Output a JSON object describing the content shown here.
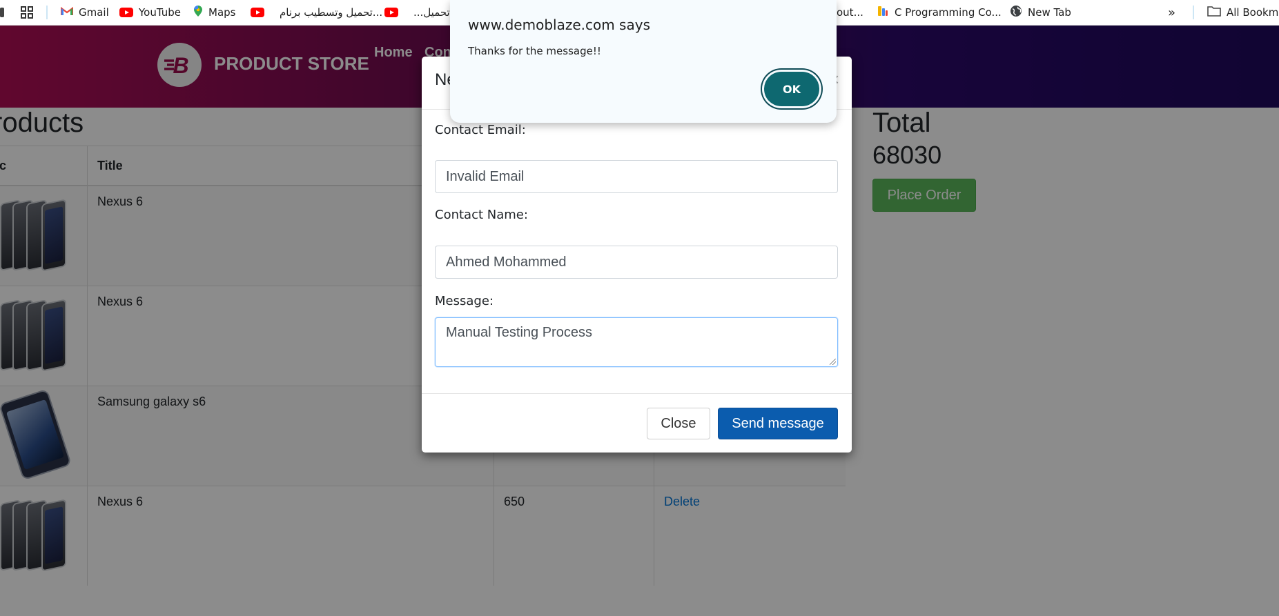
{
  "bookmarks": {
    "items": [
      {
        "icon": "gmail-icon",
        "label": "Gmail"
      },
      {
        "icon": "youtube-icon",
        "label": "YouTube"
      },
      {
        "icon": "maps-icon",
        "label": "Maps"
      },
      {
        "icon": "youtube-icon",
        "label": "تحميل وتسطيب برنام..."
      },
      {
        "icon": "youtube-icon",
        "label": "...ن تحميل"
      },
      {
        "icon": "bookmark-icon",
        "label": "out..."
      },
      {
        "icon": "c-programming-icon",
        "label": "C Programming Co..."
      },
      {
        "icon": "globe-icon",
        "label": "New Tab"
      }
    ],
    "more_label": "»",
    "all_bookmarks_label": "All Bookma"
  },
  "navbar": {
    "brand": "PRODUCT STORE",
    "links": [
      "Home",
      "Con"
    ]
  },
  "cart": {
    "heading": "roducts",
    "columns": [
      "ic",
      "Title",
      "",
      ""
    ],
    "rows": [
      {
        "title": "Nexus 6",
        "price": "",
        "action": ""
      },
      {
        "title": "Nexus 6",
        "price": "",
        "action": ""
      },
      {
        "title": "Samsung galaxy s6",
        "price": "",
        "action": ""
      },
      {
        "title": "Nexus 6",
        "price": "650",
        "action": "Delete"
      }
    ],
    "total_heading": "Total",
    "total_value": "68030",
    "place_order": "Place Order"
  },
  "modal": {
    "title": "Ne",
    "close_x": "×",
    "email_label": "Contact Email:",
    "email_value": "Invalid Email",
    "name_label": "Contact Name:",
    "name_value": "Ahmed Mohammed",
    "message_label": "Message:",
    "message_value": "Manual Testing Process",
    "close_button": "Close",
    "send_button": "Send message"
  },
  "alert": {
    "title": "www.demoblaze.com says",
    "message": "Thanks for the message!!",
    "ok_button": "OK"
  },
  "colors": {
    "navbar_start": "#b00e55",
    "navbar_end": "#1f0a5d",
    "send_button": "#0b5cae",
    "place_order": "#5cb85c",
    "alert_ok": "#0e6870"
  }
}
